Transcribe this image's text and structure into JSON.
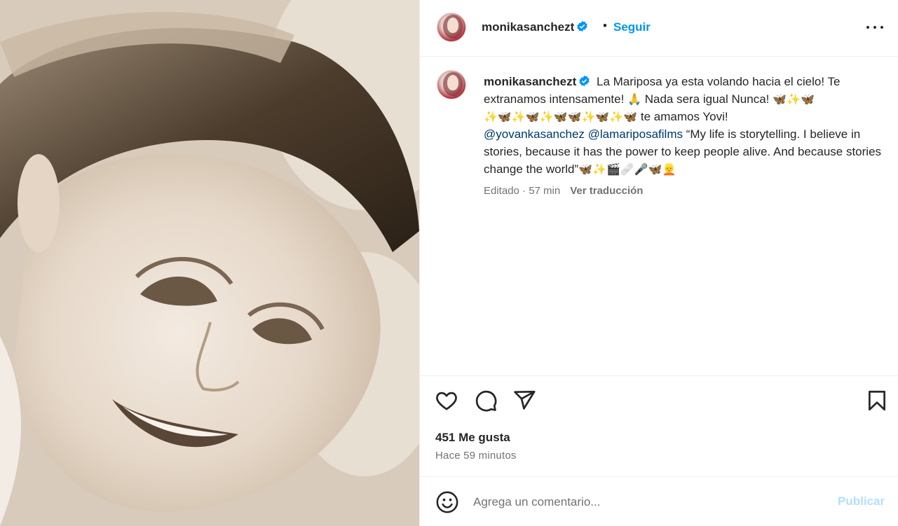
{
  "post": {
    "image_alt": "Sepia portrait photo"
  },
  "header": {
    "username": "monikasanchezt",
    "separator": "•",
    "follow_label": "Seguir",
    "more_icon": "more-horizontal-icon"
  },
  "caption": {
    "username": "monikasanchezt",
    "text_1": "La Mariposa ya esta volando hacia el cielo! Te extranamos intensamente! ",
    "emoji_pray": "🙏",
    "text_2": " Nada sera igual Nunca! ",
    "emoji_row_1": "🦋✨🦋",
    "emoji_row_2": "✨🦋✨🦋✨🦋🦋✨🦋✨🦋",
    "text_3": " te amamos Yovi!",
    "mention_1": "@yovankasanchez",
    "mention_2": "@lamariposafilms",
    "text_4": " “My life is storytelling. I believe in stories, because it has the power to keep people alive. And because stories change the world”",
    "emoji_end": "🦋✨🎬🩹🎤🦋👱"
  },
  "meta": {
    "edited": "Editado · 57 min",
    "translate_label": "Ver traducción"
  },
  "actions": {
    "like_icon": "heart-icon",
    "comment_icon": "comment-icon",
    "share_icon": "send-icon",
    "save_icon": "bookmark-icon",
    "likes": "451 Me gusta",
    "time": "Hace 59 minutos"
  },
  "comment": {
    "placeholder": "Agrega un comentario...",
    "publish_label": "Publicar"
  },
  "colors": {
    "link_blue": "#0095f6",
    "mention_blue": "#00376b",
    "publish_disabled": "#b2dffc",
    "secondary_text": "#737373"
  }
}
